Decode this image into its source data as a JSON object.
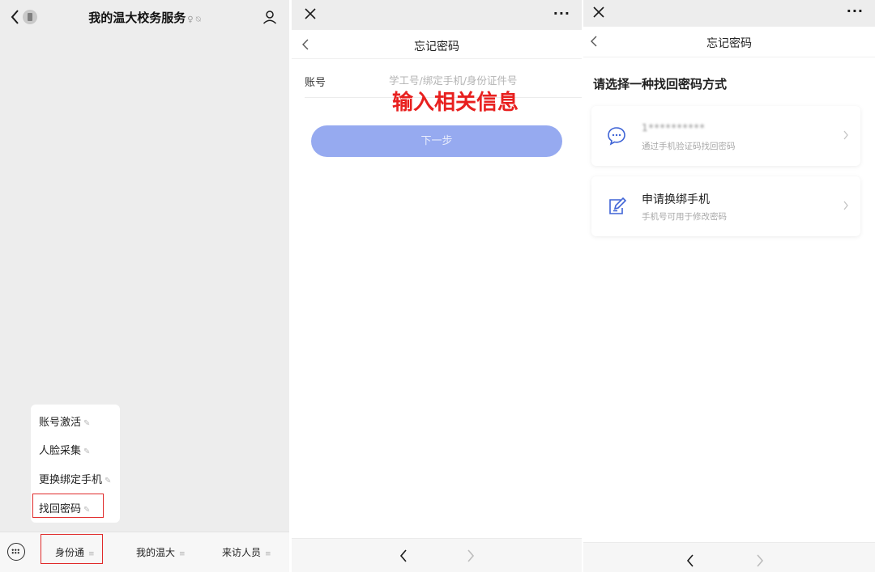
{
  "panel1": {
    "chat_title": "我的温大校务服务",
    "popup_menu": [
      {
        "label": "账号激活",
        "edit_icon": "pencil-icon"
      },
      {
        "label": "人脸采集",
        "edit_icon": "pencil-icon"
      },
      {
        "label": "更换绑定手机",
        "edit_icon": "pencil-icon"
      },
      {
        "label": "找回密码",
        "edit_icon": "pencil-icon"
      }
    ],
    "bottom_menu": [
      {
        "label": "身份通",
        "menu_mark": "≡"
      },
      {
        "label": "我的温大",
        "menu_mark": "≡"
      },
      {
        "label": "来访人员",
        "menu_mark": "≡"
      }
    ],
    "highlight_color": "#e02b2b"
  },
  "panel2": {
    "nav_title": "忘记密码",
    "account_label": "账号",
    "account_placeholder": "学工号/绑定手机/身份证件号",
    "annotation": "输入相关信息",
    "next_button": "下一步",
    "button_color": "#96aaf0",
    "annotation_color": "#e8201f"
  },
  "panel3": {
    "nav_title": "忘记密码",
    "choose_title": "请选择一种找回密码方式",
    "options": [
      {
        "icon": "message-bubble-icon",
        "main": "1**********",
        "sub": "通过手机验证码找回密码"
      },
      {
        "icon": "edit-document-icon",
        "main": "申请换绑手机",
        "sub": "手机号可用于修改密码"
      }
    ],
    "icon_color": "#3f64d6"
  }
}
